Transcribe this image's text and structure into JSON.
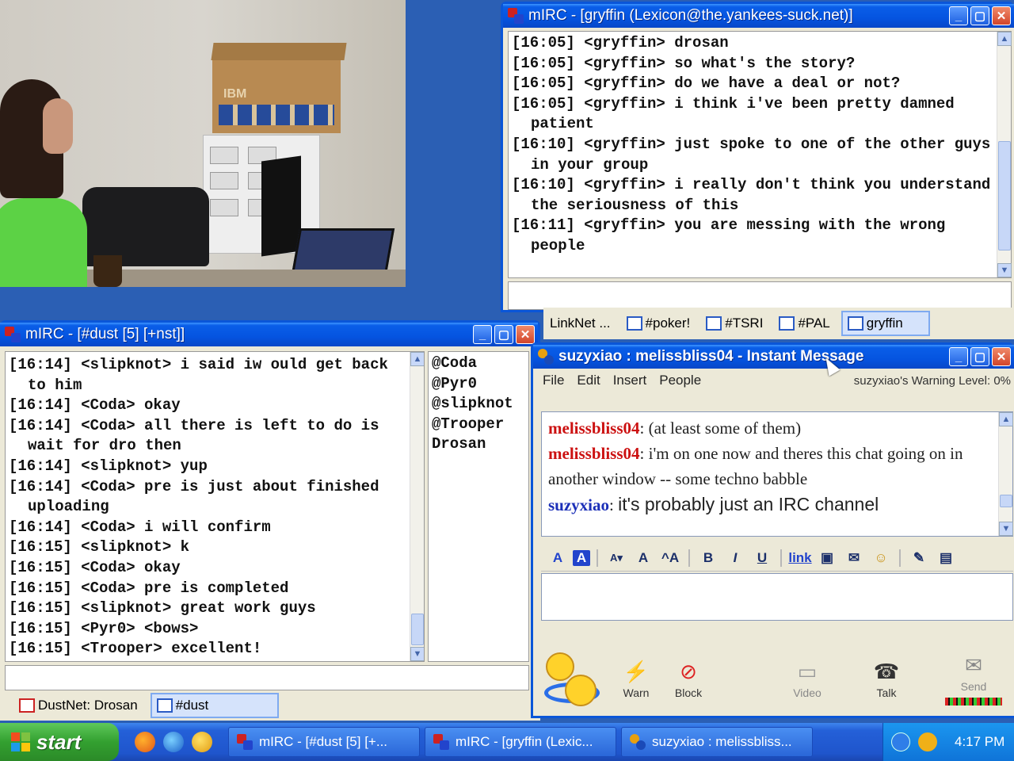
{
  "gryffin_window": {
    "title": "mIRC - [gryffin (Lexicon@the.yankees-suck.net)]",
    "lines": [
      "[16:05] <gryffin> drosan",
      "[16:05] <gryffin> so what's the story?",
      "[16:05] <gryffin> do we have a deal or not?",
      "[16:05] <gryffin> i think i've been pretty damned patient",
      "[16:10] <gryffin> just spoke to one of the other guys in your group",
      "[16:10] <gryffin> i really don't think you understand the seriousness of this",
      "[16:11] <gryffin> you are messing with the wrong people"
    ]
  },
  "switchbar": {
    "items": [
      "LinkNet ...",
      "#poker!",
      "#TSRI",
      "#PAL",
      "gryffin"
    ],
    "active": "gryffin"
  },
  "dust_window": {
    "title": "mIRC - [#dust [5] [+nst]]",
    "lines": [
      "[16:14] <slipknot> i said iw ould get back to him",
      "[16:14] <Coda> okay",
      "[16:14] <Coda> all there is left to do is wait for dro then",
      "[16:14] <slipknot> yup",
      "[16:14] <Coda> pre is just about finished uploading",
      "[16:14] <Coda> i will confirm",
      "[16:15] <slipknot> k",
      "[16:15] <Coda> okay",
      "[16:15] <Coda> pre is completed",
      "[16:15] <slipknot> great work guys",
      "[16:15] <Pyr0> <bows>",
      "[16:15] <Trooper> excellent!"
    ],
    "nicks": [
      "@Coda",
      "@Pyr0",
      "@slipknot",
      "@Trooper",
      "Drosan"
    ],
    "switchbar": [
      "DustNet: Drosan",
      "#dust"
    ]
  },
  "im_window": {
    "title": "suzyxiao : melissbliss04 - Instant Message",
    "menu": [
      "File",
      "Edit",
      "Insert",
      "People"
    ],
    "warning_level": "suzyxiao's Warning Level: 0%",
    "messages": [
      {
        "nick": "melissbliss04",
        "sep": ": ",
        "text": "(at least some of them)"
      },
      {
        "nick": "melissbliss04",
        "sep": ": ",
        "text": "i'm on one now and theres this chat going on in another window -- some techno babble"
      },
      {
        "nick": "suzyxiao",
        "sep": ": ",
        "text": "it's probably just an IRC channel"
      }
    ],
    "format_buttons": [
      "A",
      "A",
      "A▾",
      "A",
      "^A",
      "B",
      "I",
      "U",
      "link"
    ],
    "actions": [
      "Warn",
      "Block",
      "Video",
      "Talk",
      "Send"
    ]
  },
  "taskbar": {
    "start": "start",
    "tasks": [
      "mIRC - [#dust [5] [+...",
      "mIRC - [gryffin (Lexic...",
      "suzyxiao : melissbliss..."
    ],
    "clock": "4:17 PM"
  },
  "video": {
    "box_brand": "IBM"
  }
}
